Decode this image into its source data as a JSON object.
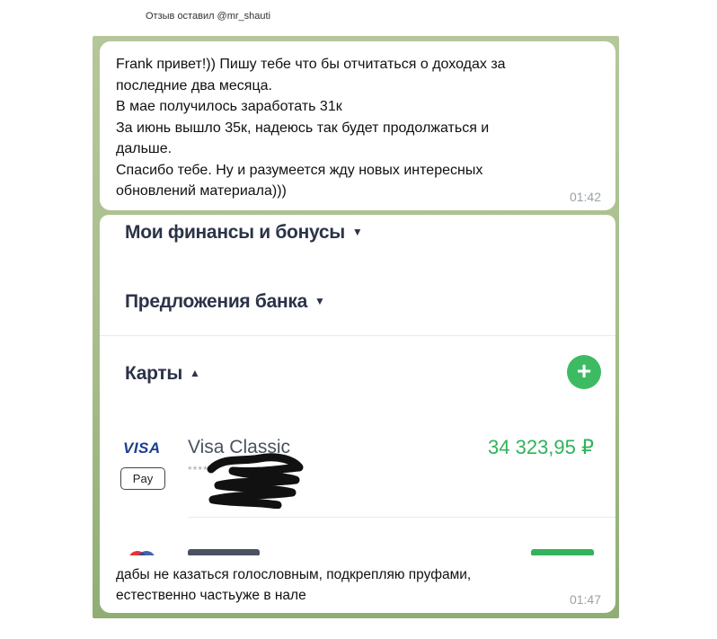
{
  "caption": "Отзыв оставил @mr_shauti",
  "messages": [
    {
      "lines": [
        "Frank привет!)) Пишу тебе что бы отчитаться о доходах за",
        "последние два месяца.",
        "В мае получилось заработать 31к",
        "За июнь вышло 35к, надеюсь так будет продолжаться и",
        "дальше.",
        "Спасибо тебе. Ну и разумеется жду новых интересных",
        "обновлений материала)))"
      ],
      "time": "01:42"
    },
    {
      "lines": [
        "дабы не казаться голословным, подкрепляю пруфами,",
        "естественно частьуже в нале"
      ],
      "time": "01:47"
    }
  ],
  "bank": {
    "section_finances": "Мои финансы и бонусы",
    "section_offers": "Предложения банка",
    "section_cards": "Карты",
    "caret_down": "▼",
    "caret_up": "▲",
    "add_icon": "plus-icon",
    "add_symbol": "+",
    "card": {
      "brand": "VISA",
      "wallet": " Pay",
      "name": "Visa Classic",
      "mask": "****",
      "balance": "34 323,95 ₽"
    }
  },
  "colors": {
    "chat_background": "#a6bd8a",
    "accent_green": "#3dbb63",
    "balance_green": "#32b25a",
    "visa_blue": "#1a3f8f"
  }
}
